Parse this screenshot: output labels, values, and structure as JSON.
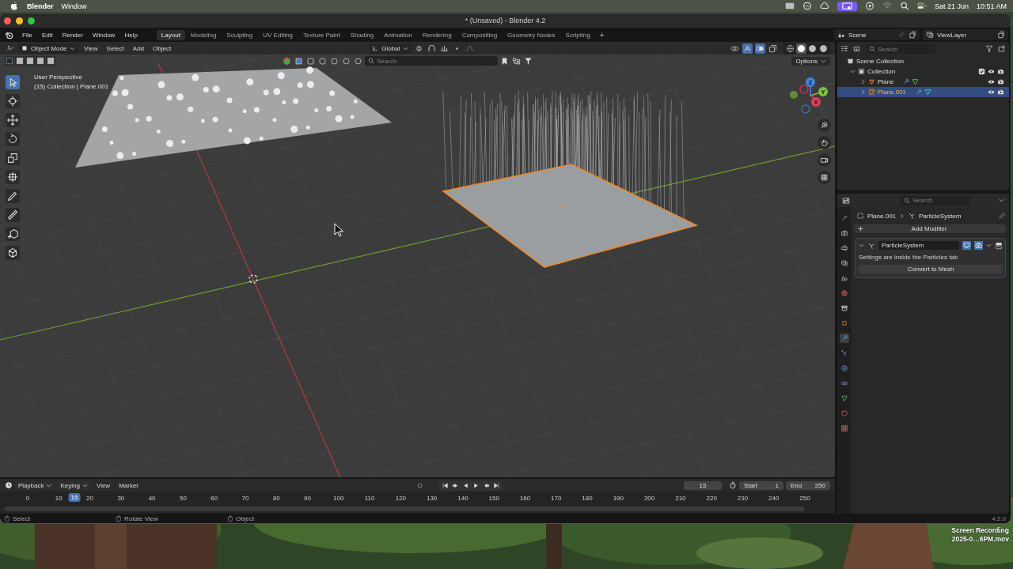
{
  "menubar": {
    "app": "Blender",
    "menus": [
      "Window"
    ],
    "date": "Sat 21 Jun",
    "time": "10:51 AM"
  },
  "window": {
    "title": "* (Unsaved) - Blender 4.2"
  },
  "topbar": {
    "menus": [
      "File",
      "Edit",
      "Render",
      "Window",
      "Help"
    ],
    "workspaces": [
      {
        "label": "Layout",
        "selected": true
      },
      {
        "label": "Modeling",
        "selected": false
      },
      {
        "label": "Sculpting",
        "selected": false
      },
      {
        "label": "UV Editing",
        "selected": false
      },
      {
        "label": "Texture Paint",
        "selected": false
      },
      {
        "label": "Shading",
        "selected": false
      },
      {
        "label": "Animation",
        "selected": false
      },
      {
        "label": "Rendering",
        "selected": false
      },
      {
        "label": "Compositing",
        "selected": false
      },
      {
        "label": "Geometry Nodes",
        "selected": false
      },
      {
        "label": "Scripting",
        "selected": false
      }
    ],
    "add_workspace": "+",
    "scene": "Scene",
    "view_layer": "ViewLayer"
  },
  "viewport": {
    "mode": "Object Mode",
    "menus": [
      "View",
      "Select",
      "Add",
      "Object"
    ],
    "orientation": "Global",
    "search": {
      "placeholder": "Search"
    },
    "options": "Options",
    "perspective": "User Perspective",
    "info": "(15) Collection | Plane.001",
    "shading": [
      {
        "kind": "wireframe",
        "selected": false
      },
      {
        "kind": "solid",
        "selected": true
      },
      {
        "kind": "material",
        "selected": false
      },
      {
        "kind": "rendered",
        "selected": false
      }
    ],
    "tools": [
      {
        "kind": "select",
        "selected": true
      },
      {
        "kind": "cursor",
        "selected": false
      },
      {
        "kind": "move",
        "selected": false
      },
      {
        "kind": "rotate",
        "selected": false
      },
      {
        "kind": "scale",
        "selected": false
      },
      {
        "kind": "transform",
        "selected": false
      },
      {
        "kind": "annotate",
        "selected": false
      },
      {
        "kind": "measure",
        "selected": false
      },
      {
        "kind": "add_cube",
        "selected": false
      },
      {
        "kind": "cube",
        "selected": false
      }
    ],
    "gizmo_axes": [
      "Z",
      "Y",
      "X"
    ]
  },
  "outliner": {
    "search": {
      "placeholder": "Search"
    },
    "root": "Scene Collection",
    "collections": [
      {
        "label": "Collection",
        "expanded": true,
        "checked": true,
        "children": [
          {
            "label": "Plane",
            "selected": false,
            "expanded": false
          },
          {
            "label": "Plane.001",
            "selected": true,
            "expanded": false
          }
        ]
      }
    ]
  },
  "properties": {
    "search": {
      "placeholder": "Search"
    },
    "tabs": [
      {
        "kind": "tool",
        "selected": false
      },
      {
        "kind": "render",
        "selected": false
      },
      {
        "kind": "output",
        "selected": false
      },
      {
        "kind": "view_layer",
        "selected": false
      },
      {
        "kind": "scene",
        "selected": false
      },
      {
        "kind": "world",
        "selected": false
      },
      {
        "kind": "collection",
        "selected": false
      },
      {
        "kind": "object",
        "selected": false
      },
      {
        "kind": "modifiers",
        "selected": true
      },
      {
        "kind": "particles",
        "selected": false
      },
      {
        "kind": "physics",
        "selected": false
      },
      {
        "kind": "constraints",
        "selected": false
      },
      {
        "kind": "data",
        "selected": false
      },
      {
        "kind": "material",
        "selected": false
      },
      {
        "kind": "texture",
        "selected": false
      }
    ],
    "breadcrumb": {
      "object": "Plane.001",
      "modifier": "ParticleSystem"
    },
    "add_modifier": "Add Modifier",
    "modifiers": [
      {
        "name": "ParticleSystem",
        "expanded": true,
        "show_viewport": true,
        "show_render": true,
        "message": "Settings are inside the Particles tab",
        "action": "Convert to Mesh"
      }
    ]
  },
  "timeline": {
    "menus": [
      {
        "label": "Playback",
        "dropdown": true
      },
      {
        "label": "Keying",
        "dropdown": true
      },
      {
        "label": "View",
        "dropdown": false
      },
      {
        "label": "Marker",
        "dropdown": false
      }
    ],
    "current_frame": "15",
    "start_label": "Start",
    "start": "1",
    "end_label": "End",
    "end": "250",
    "ticks": [
      "0",
      "10",
      "20",
      "30",
      "40",
      "50",
      "60",
      "70",
      "80",
      "90",
      "100",
      "110",
      "120",
      "130",
      "140",
      "150",
      "160",
      "170",
      "180",
      "190",
      "200",
      "210",
      "220",
      "230",
      "240",
      "250"
    ],
    "playhead": {
      "label": "15",
      "level": 0.06
    }
  },
  "status_bar": {
    "hints": [
      "Select",
      "Rotate View",
      "Object"
    ],
    "version": "4.2.0"
  },
  "desktop": {
    "wallpaper": {
      "kind": "picture"
    },
    "file_label": [
      "Screen Recording",
      "2025-0…6PM.mov"
    ]
  }
}
